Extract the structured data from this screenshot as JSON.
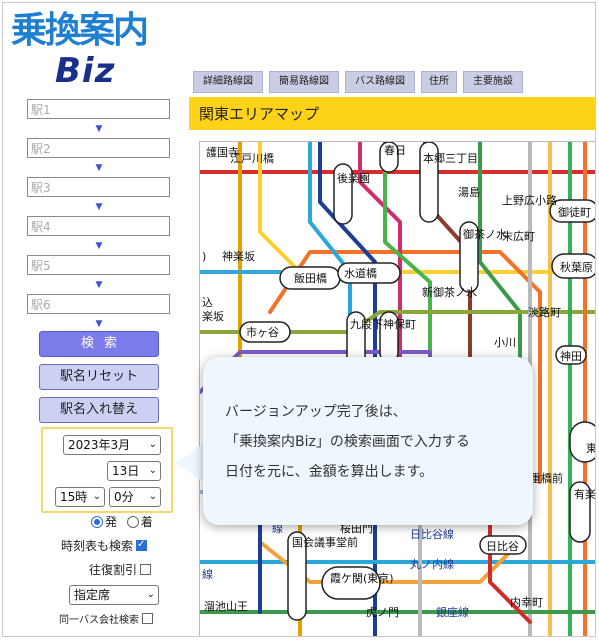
{
  "logo": {
    "line1": "乗換案内",
    "line2": "Biz"
  },
  "stations": [
    "駅1",
    "駅2",
    "駅3",
    "駅4",
    "駅5",
    "駅6"
  ],
  "arrow_glyph": "▼",
  "buttons": {
    "search": "検索",
    "reset": "駅名リセット",
    "swap": "駅名入れ替え"
  },
  "date": {
    "year_month": "2023年3月",
    "day": "13日",
    "hour": "15時",
    "minute": "0分"
  },
  "radio": {
    "depart": "発",
    "arrive": "着",
    "selected": "depart"
  },
  "options": [
    {
      "label": "時刻表も検索",
      "checked": true
    },
    {
      "label": "往復割引",
      "checked": false
    }
  ],
  "seat_select": "指定席",
  "bus_option": {
    "label": "同一バス会社検索",
    "checked": false
  },
  "tabs": [
    "詳細路線図",
    "簡易路線図",
    "バス路線図",
    "住所",
    "主要施設"
  ],
  "map_title": "関東エリアマップ",
  "map_labels": {
    "gokokuji": "護国寺",
    "edogawabashi": "江戸川橋",
    "kagurazaka": "神楽坂",
    "iidabashi": "飯田橋",
    "ichigaya": "市ヶ谷",
    "kasuga": "春日",
    "korakuen": "後楽園",
    "hongo": "本郷三丁目",
    "yushima": "湯島",
    "ueno": "上野広小路",
    "okachimachi": "御徒町",
    "suehirocho": "末広町",
    "akihabara": "秋葉原",
    "ochanomizu": "御茶ノ水",
    "shinochanomizu": "新御茶ノ水",
    "suidobashi": "水道橋",
    "kudanshita": "九段下",
    "jimbocho": "神保町",
    "awajicho": "淡路町",
    "ogawamachi": "小川",
    "kanda": "神田",
    "yurakucho": "有楽町",
    "toudai": "東",
    "ginzaitchome": "重橋前",
    "sakuradamon": "桜田門",
    "hibiya_line": "日比谷線",
    "hibiya": "日比谷",
    "kokkai": "国会議事堂前",
    "kasumigaseki": "霞ケ関(東京)",
    "marunouchi": "丸ノ内線",
    "tameike": "溜池山王",
    "toranomon": "虎ノ門",
    "ginza_line": "銀座線",
    "uchisaiwaicho": "内幸町",
    "sen": "線",
    "ko": "込",
    "rakuzaka": "楽坂",
    "paren": ")",
    "line_fragment": "線"
  },
  "callout": {
    "line1": "バージョンアップ完了後は、",
    "line2": "「乗換案内Biz」の検索画面で入力する",
    "line3": "日付を元に、金額を算出します。"
  }
}
